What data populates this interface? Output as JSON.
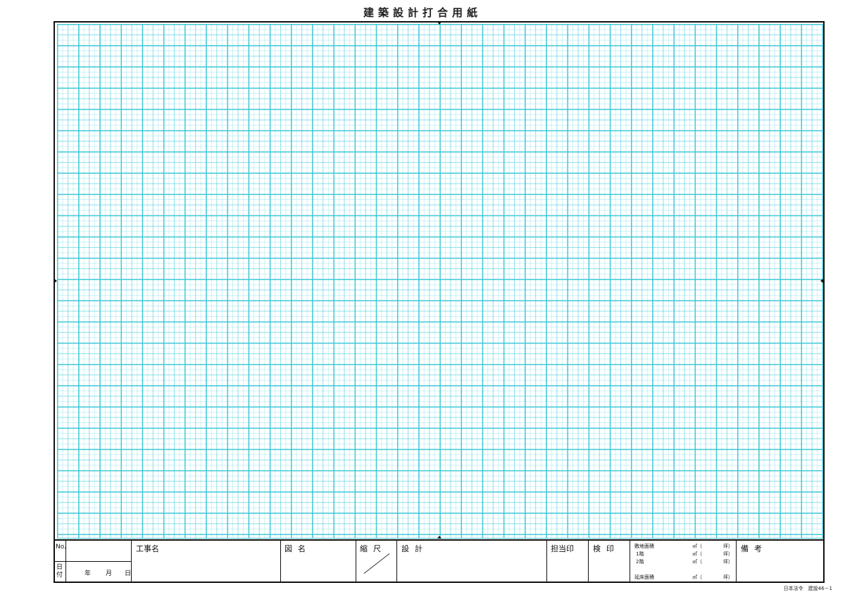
{
  "title": "建築設計打合用紙",
  "title_block": {
    "no_label": "No.",
    "date_label": "日付",
    "date_year": "年",
    "date_month": "月",
    "date_day": "日",
    "project_name_label": "工事名",
    "drawing_name_label": "図名",
    "scale_label": "縮尺",
    "design_label": "設計",
    "person_in_charge_label": "担当印",
    "inspection_label": "検印",
    "area": {
      "site_area_label": "敷地面積",
      "floor1_label": "1階",
      "floor2_label": "2階",
      "total_floor_label": "延床面積",
      "unit_sqm": "㎡（",
      "unit_tsubo": "坪）"
    },
    "remarks_label": "備考"
  },
  "footer": "日本法令　建設46－1",
  "colors": {
    "grid_line": "#3cc8d7",
    "frame": "#111111"
  }
}
